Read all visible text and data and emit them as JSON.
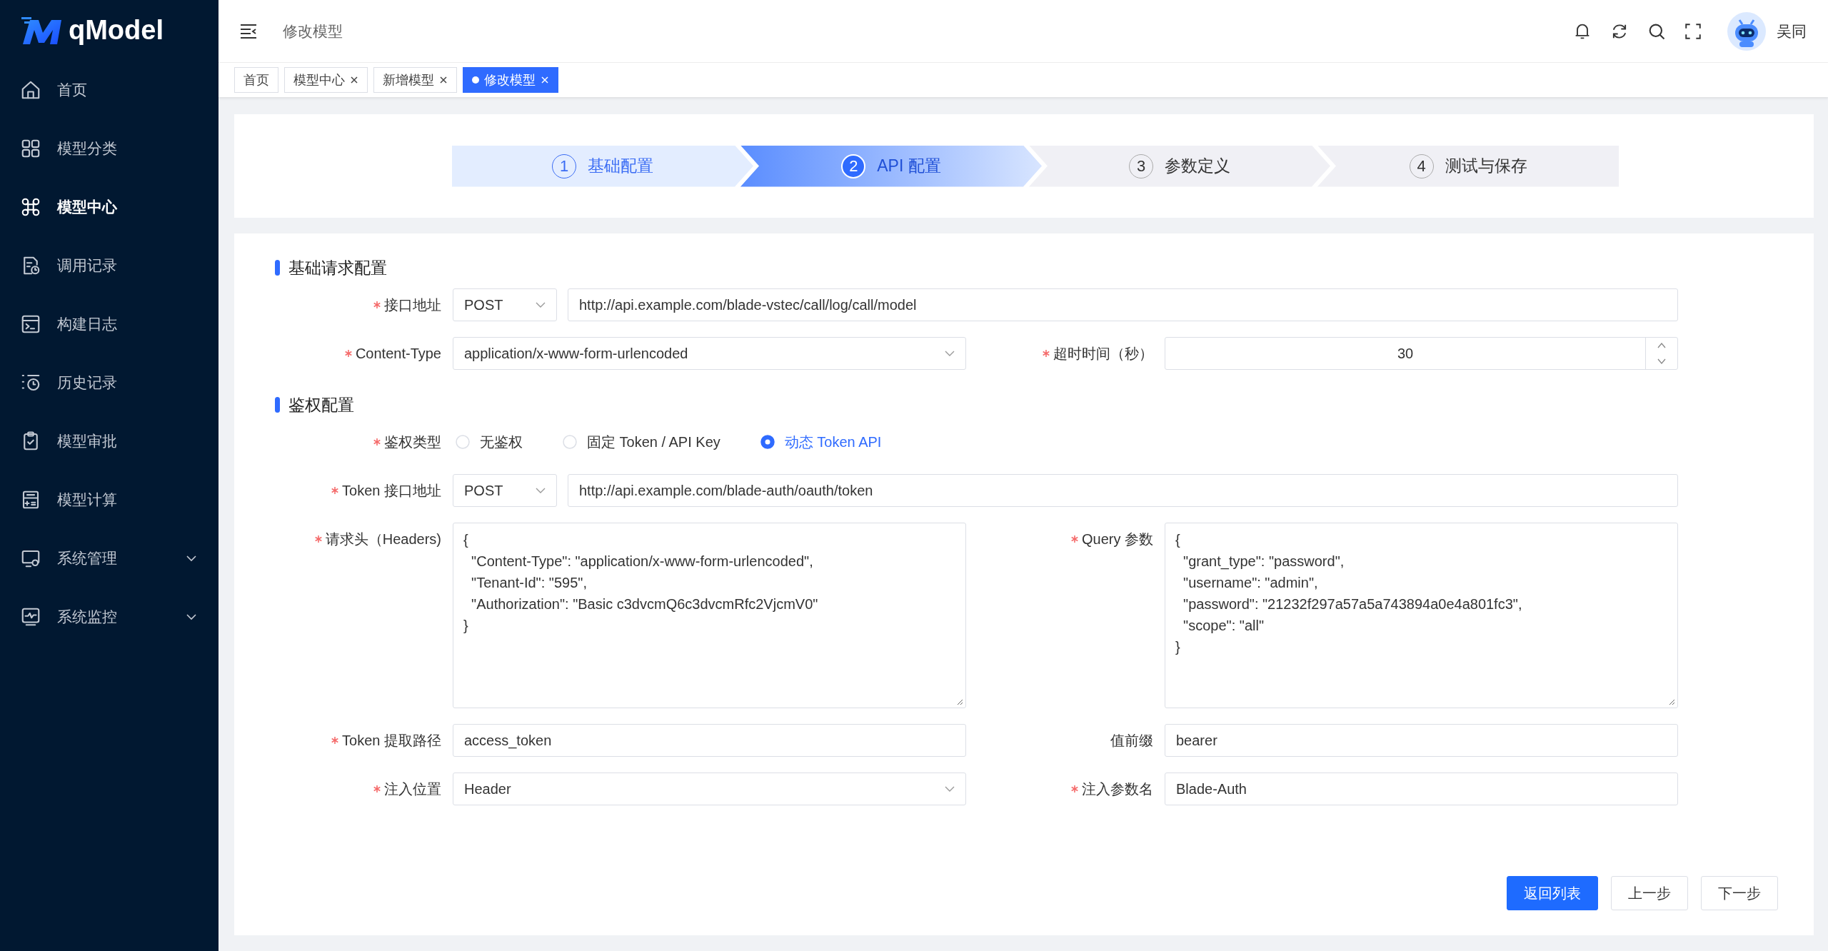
{
  "logo": {
    "text": "qModel"
  },
  "sidebar": {
    "items": [
      {
        "label": "首页",
        "selected": false,
        "expandable": false
      },
      {
        "label": "模型分类",
        "selected": false,
        "expandable": false
      },
      {
        "label": "模型中心",
        "selected": true,
        "expandable": false
      },
      {
        "label": "调用记录",
        "selected": false,
        "expandable": false
      },
      {
        "label": "构建日志",
        "selected": false,
        "expandable": false
      },
      {
        "label": "历史记录",
        "selected": false,
        "expandable": false
      },
      {
        "label": "模型审批",
        "selected": false,
        "expandable": false
      },
      {
        "label": "模型计算",
        "selected": false,
        "expandable": false
      },
      {
        "label": "系统管理",
        "selected": false,
        "expandable": true
      },
      {
        "label": "系统监控",
        "selected": false,
        "expandable": true
      }
    ]
  },
  "header": {
    "breadcrumb": "修改模型",
    "user": "吴同"
  },
  "tabs": [
    {
      "label": "首页",
      "selected": false,
      "closable": false
    },
    {
      "label": "模型中心",
      "selected": false,
      "closable": true
    },
    {
      "label": "新增模型",
      "selected": false,
      "closable": true
    },
    {
      "label": "修改模型",
      "selected": true,
      "closable": true
    }
  ],
  "steps": [
    {
      "number": "1",
      "label": "基础配置",
      "completed": true,
      "selected": false
    },
    {
      "number": "2",
      "label": "API 配置",
      "completed": false,
      "selected": true
    },
    {
      "number": "3",
      "label": "参数定义",
      "completed": false,
      "selected": false
    },
    {
      "number": "4",
      "label": "测试与保存",
      "completed": false,
      "selected": false
    }
  ],
  "sections": [
    {
      "title": "基础请求配置",
      "rows": [
        [
          {
            "kind": "method_url",
            "label": "接口地址",
            "required": true,
            "method": "POST",
            "value": "http://api.example.com/blade-vstec/call/log/call/model"
          }
        ],
        [
          {
            "kind": "select",
            "label": "Content-Type",
            "required": true,
            "value": "application/x-www-form-urlencoded"
          },
          {
            "kind": "number",
            "label": "超时时间（秒）",
            "required": true,
            "value": "30"
          }
        ]
      ]
    },
    {
      "title": "鉴权配置",
      "rows": [
        [
          {
            "kind": "radio",
            "label": "鉴权类型",
            "required": true,
            "options": [
              {
                "label": "无鉴权",
                "selected": false
              },
              {
                "label": "固定 Token / API Key",
                "selected": false
              },
              {
                "label": "动态 Token API",
                "selected": true
              }
            ]
          }
        ],
        [
          {
            "kind": "method_url",
            "label": "Token 接口地址",
            "required": true,
            "method": "POST",
            "value": "http://api.example.com/blade-auth/oauth/token"
          }
        ],
        [
          {
            "kind": "textarea",
            "label": "请求头（Headers)",
            "required": true,
            "value": "{\n  \"Content-Type\": \"application/x-www-form-urlencoded\",\n  \"Tenant-Id\": \"595\",\n  \"Authorization\": \"Basic c3dvcmQ6c3dvcmRfc2VjcmV0\"\n}"
          },
          {
            "kind": "textarea",
            "label": "Query 参数",
            "required": true,
            "value": "{\n  \"grant_type\": \"password\",\n  \"username\": \"admin\",\n  \"password\": \"21232f297a57a5a743894a0e4a801fc3\",\n  \"scope\": \"all\"\n}"
          }
        ],
        [
          {
            "kind": "text",
            "label": "Token 提取路径",
            "required": true,
            "value": "access_token"
          },
          {
            "kind": "text",
            "label": "值前缀",
            "required": false,
            "value": "bearer"
          }
        ],
        [
          {
            "kind": "select",
            "label": "注入位置",
            "required": true,
            "value": "Header"
          },
          {
            "kind": "text",
            "label": "注入参数名",
            "required": true,
            "value": "Blade-Auth"
          }
        ]
      ]
    }
  ],
  "buttons": [
    {
      "label": "返回列表",
      "kind": "primary"
    },
    {
      "label": "上一步",
      "kind": "default"
    },
    {
      "label": "下一步",
      "kind": "default"
    }
  ]
}
